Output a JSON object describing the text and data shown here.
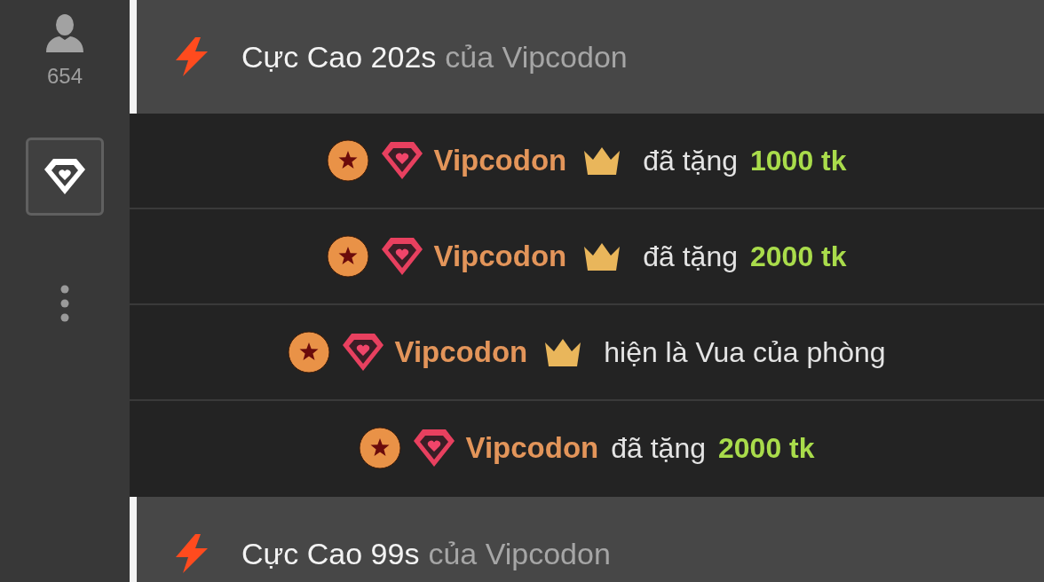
{
  "sidebar": {
    "viewer_count": "654",
    "tabs": [
      {
        "kind": "gifts",
        "selected": true
      }
    ]
  },
  "feed": [
    {
      "kind": "header",
      "title": "Cực Cao 202s",
      "byline": "của Vipcodon"
    },
    {
      "kind": "event",
      "user": "Vipcodon",
      "crown": true,
      "message": "đã tặng",
      "amount": "1000 tk"
    },
    {
      "kind": "event",
      "user": "Vipcodon",
      "crown": true,
      "message": "đã tặng",
      "amount": "2000 tk"
    },
    {
      "kind": "event",
      "user": "Vipcodon",
      "crown": true,
      "message": "hiện là Vua của phòng"
    },
    {
      "kind": "event",
      "user": "Vipcodon",
      "crown": false,
      "message": "đã tặng",
      "amount": "2000 tk"
    },
    {
      "kind": "header",
      "title": "Cực Cao 99s",
      "byline": "của Vipcodon"
    }
  ]
}
